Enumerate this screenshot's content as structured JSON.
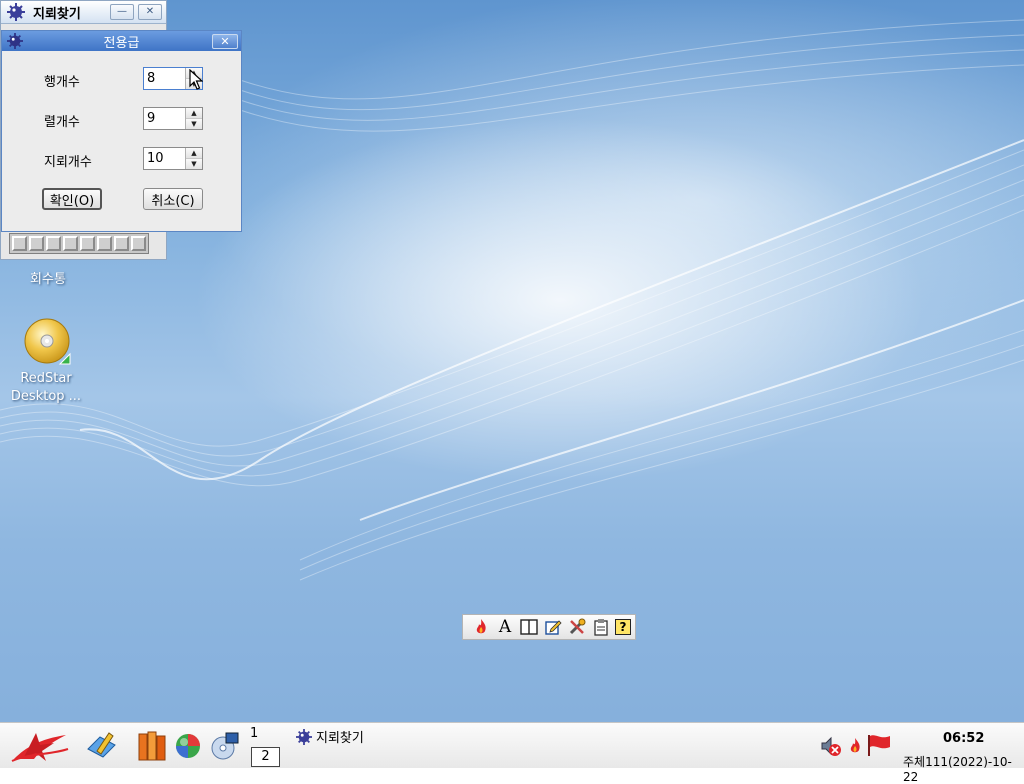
{
  "background_window": {
    "title": "지뢰찾기",
    "minimize_label": "—",
    "close_label": "✕"
  },
  "dialog": {
    "title": "전용급",
    "close_label": "✕",
    "fields": [
      {
        "label": "행개수",
        "value": "8"
      },
      {
        "label": "렬개수",
        "value": "9"
      },
      {
        "label": "지뢰개수",
        "value": "10"
      }
    ],
    "ok_label": "확인(O)",
    "cancel_label": "취소(C)"
  },
  "desktop": {
    "icons": [
      {
        "label": "회수통",
        "icon": "trash-icon"
      },
      {
        "label": "RedStar\nDesktop ...",
        "icon": "cd-icon"
      }
    ]
  },
  "floating_toolbar": {
    "items": [
      "flame-icon",
      "font-icon",
      "layout-icon",
      "edit-icon",
      "tools-icon",
      "clipboard-icon",
      "help-icon"
    ],
    "font_glyph": "A",
    "help_glyph": "?"
  },
  "taskbar": {
    "launchers": [
      "redstar-menu-icon",
      "notepad-icon",
      "office-icon",
      "browser-icon",
      "media-icon"
    ],
    "pager": [
      "1",
      "2"
    ],
    "task_title": "지뢰찾기",
    "tray": [
      "speaker-muted-icon",
      "ime-icon",
      "flag-icon"
    ],
    "time": "06:52",
    "date": "주체111(2022)-10-22"
  },
  "colors": {
    "dialog_title": "#4a7fd0",
    "desktop_blue": "#7fadde"
  }
}
